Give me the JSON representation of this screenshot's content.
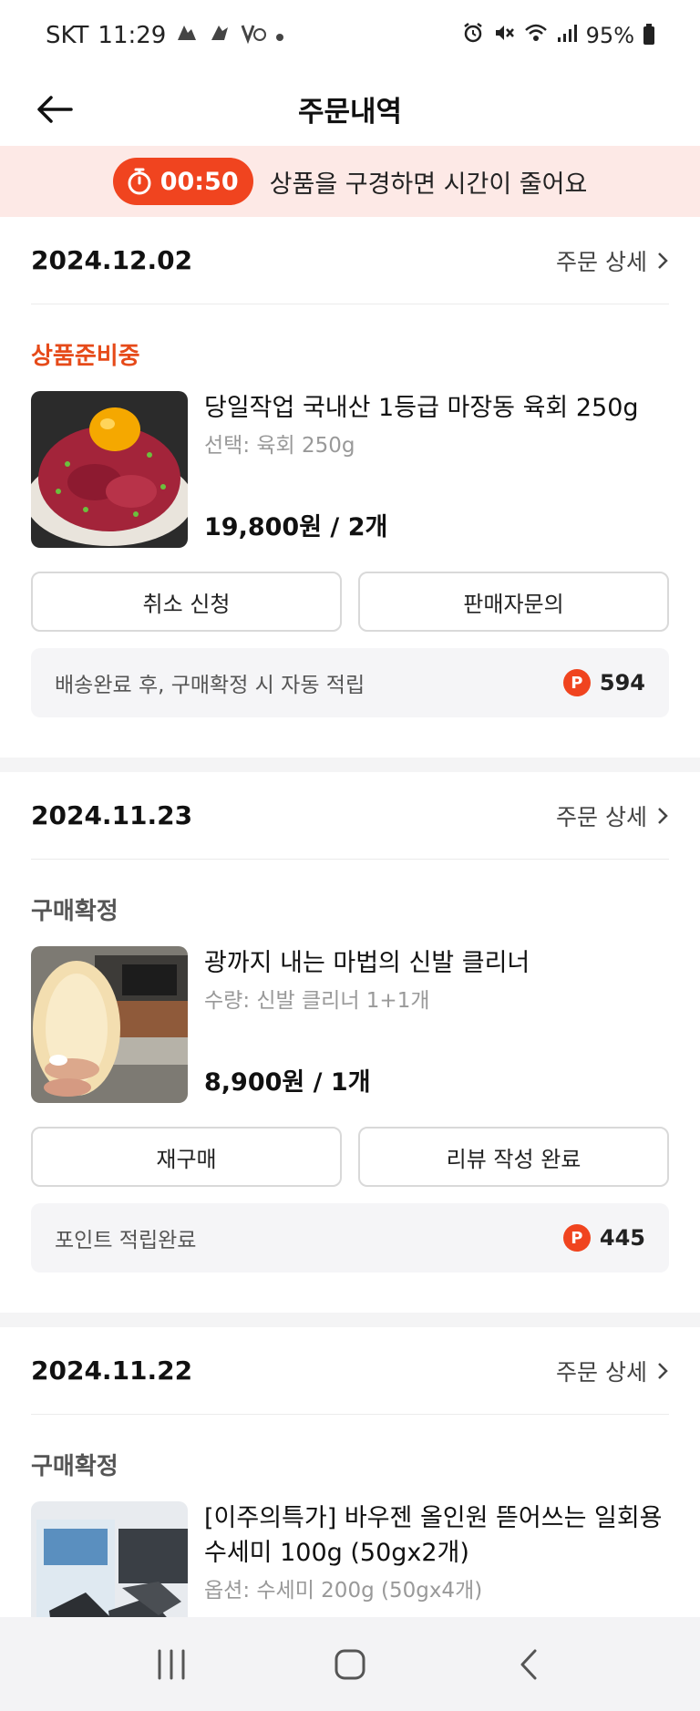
{
  "status_bar": {
    "carrier": "SKT",
    "time": "11:29",
    "notification_icons": [
      "app-notification-icon",
      "app-notification-icon",
      "app-notification-icon",
      "dot-icon"
    ],
    "battery": "95%",
    "icons": [
      "alarm-icon",
      "mute-icon",
      "wifi-icon",
      "signal-icon",
      "battery-icon"
    ]
  },
  "header": {
    "title": "주문내역",
    "back_icon": "arrow-left-icon"
  },
  "timer_banner": {
    "time": "00:50",
    "message": "상품을 구경하면 시간이 줄어요",
    "accent_color": "#f0441f",
    "background_color": "#fde9e6"
  },
  "orders": [
    {
      "date": "2024.12.02",
      "detail_label": "주문 상세",
      "status": "상품준비중",
      "status_color": "#e64a19",
      "product": {
        "name": "당일작업 국내산 1등급 마장동 육회 250g",
        "option": "선택: 육회 250g",
        "price": "19,800원 / 2개",
        "thumbnail": "beef-tartare-image"
      },
      "buttons": [
        "취소 신청",
        "판매자문의"
      ],
      "point_text": "배송완료 후, 구매확정 시 자동 적립",
      "point_badge": "P",
      "point_value": "594"
    },
    {
      "date": "2024.11.23",
      "detail_label": "주문 상세",
      "status": "구매확정",
      "status_color": "#555555",
      "product": {
        "name": "광까지 내는 마법의 신발 클리너",
        "option": "수량: 신발 클리너 1+1개",
        "price": "8,900원 / 1개",
        "thumbnail": "shoe-cleaner-image"
      },
      "buttons": [
        "재구매",
        "리뷰 작성 완료"
      ],
      "point_text": "포인트 적립완료",
      "point_badge": "P",
      "point_value": "445"
    },
    {
      "date": "2024.11.22",
      "detail_label": "주문 상세",
      "status": "구매확정",
      "status_color": "#555555",
      "product": {
        "name": "[이주의특가] 바우젠 올인원 뜯어쓰는 일회용 수세미 100g (50gx2개)",
        "option": "옵션: 수세미 200g (50gx4개)",
        "price": "",
        "thumbnail": "scrubber-product-image"
      }
    }
  ],
  "nav_bar": {
    "icons": [
      "recent-apps-icon",
      "home-icon",
      "back-icon"
    ]
  }
}
